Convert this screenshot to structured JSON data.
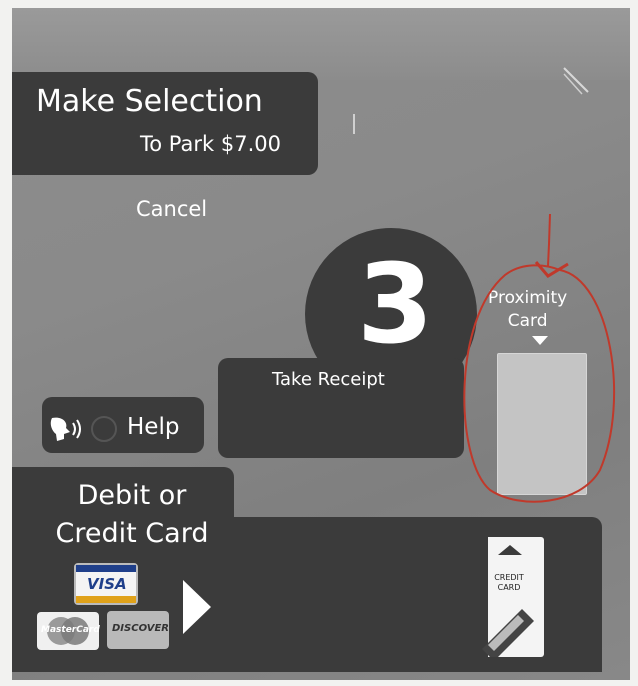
{
  "header": {
    "title": "Make Selection",
    "subtitle": "To Park $7.00"
  },
  "cancel": {
    "label": "Cancel"
  },
  "step": {
    "number": "3",
    "instruction": "Take Receipt"
  },
  "help": {
    "label": "Help",
    "icon": "audio-help-icon"
  },
  "proximity": {
    "label_line1": "Proximity",
    "label_line2": "Card",
    "icon": "down-arrow-icon"
  },
  "payment": {
    "title_line1": "Debit or",
    "title_line2": "Credit Card",
    "logos": {
      "visa": "VISA",
      "mastercard": "MasterCard",
      "discover": "DISCOVER"
    },
    "reader_label_line1": "CREDIT",
    "reader_label_line2": "CARD",
    "arrow_icon": "right-arrow-icon"
  },
  "annotation_color": "#c0392b",
  "panel_color": "#3b3b3b"
}
